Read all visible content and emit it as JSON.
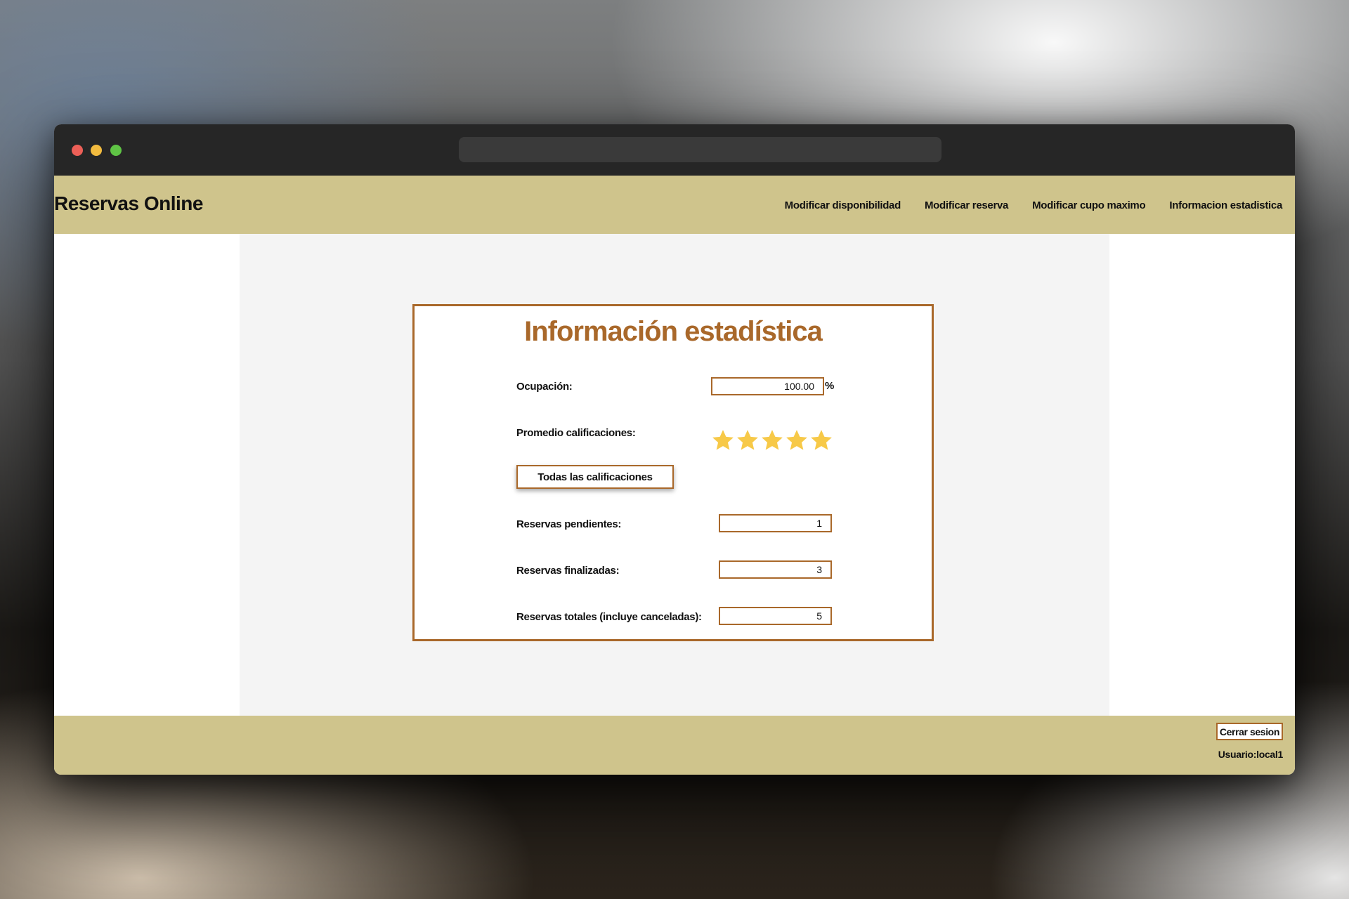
{
  "app": {
    "brand": "Reservas Online"
  },
  "nav": {
    "items": [
      {
        "label": "Modificar disponibilidad"
      },
      {
        "label": "Modificar reserva"
      },
      {
        "label": "Modificar cupo maximo"
      },
      {
        "label": "Informacion estadistica"
      }
    ]
  },
  "stats": {
    "title": "Información estadística",
    "occupancy_label": "Ocupación:",
    "occupancy_value": "100.00",
    "occupancy_unit": "%",
    "rating_label": "Promedio calificaciones:",
    "rating_stars": 5,
    "rating_max": 5,
    "all_ratings_button": "Todas las calificaciones",
    "pending_label": "Reservas pendientes:",
    "pending_value": "1",
    "finished_label": "Reservas finalizadas:",
    "finished_value": "3",
    "total_label": "Reservas totales (incluye canceladas):",
    "total_value": "5"
  },
  "footer": {
    "logout_label": "Cerrar sesion",
    "user_text": "Usuario:local1"
  },
  "colors": {
    "accent": "#a9682a",
    "bar": "#cfc48c",
    "star": "#f7c948"
  },
  "icons": [
    "star-icon"
  ]
}
